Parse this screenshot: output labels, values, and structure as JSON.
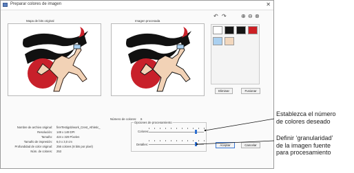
{
  "window": {
    "title": "Preparar colores de imagen",
    "close_glyph": "✕"
  },
  "panels": {
    "original_label": "Mapa de bits original",
    "processed_label": "Imagen procesada"
  },
  "toolbar": {
    "undo_glyph": "↶",
    "redo_glyph": "↷",
    "zoom_in_glyph": "⊕",
    "zoom_out_glyph": "⊖",
    "zoom_fit_glyph": "⊗"
  },
  "palette": {
    "colors": [
      "#ffffff",
      "#141414",
      "#141414",
      "#cc1f24",
      "#aad0f0",
      "#f2d7bd"
    ]
  },
  "buttons": {
    "delete": "Eliminar",
    "merge": "Fusionar",
    "ok": "Aceptar",
    "cancel": "Cancelar"
  },
  "info": {
    "rows": [
      {
        "label": "Nombre de archivo original:",
        "value": "firerTestigob/work_Crest_Athletic_"
      },
      {
        "label": "Resolución:",
        "value": "149 x 149 DPI"
      },
      {
        "label": "Tamaño:",
        "value": "424 x 329 Píxeles"
      },
      {
        "label": "Tamaño de impresión:",
        "value": "6,0 x 3,0 cm"
      },
      {
        "label": "Profundidad de color original:",
        "value": "256 colores (8 bits por píxel)"
      },
      {
        "label": "Núm. de colores:",
        "value": "253"
      }
    ]
  },
  "processing": {
    "num_colors_label": "Número de colores:",
    "num_colors_value": "6",
    "group_label": "Opciones de procesamiento",
    "colors_label": "Colores:",
    "details_label": "Detalles:",
    "colors_level": 0.86,
    "details_level": 0.86
  },
  "callouts": {
    "colors": [
      "Establezca el número",
      "de colores deseado"
    ],
    "granularity": [
      "Definir ‘granularidad’",
      "de la imagen fuente",
      "para procesamiento"
    ]
  }
}
